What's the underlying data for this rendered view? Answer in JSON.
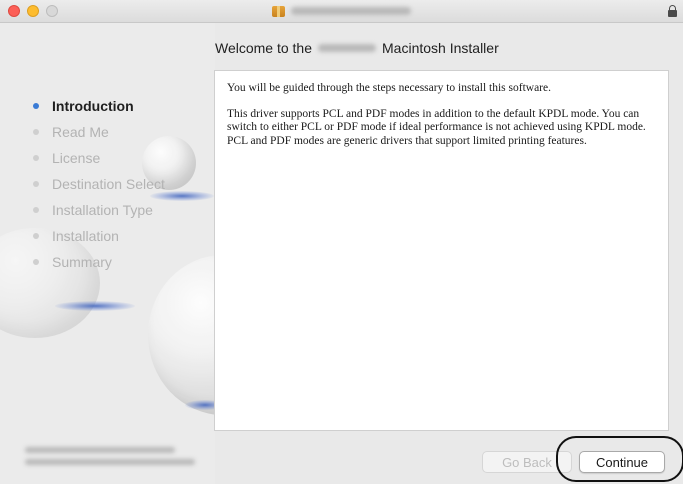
{
  "window": {
    "heading_prefix": "Welcome to the",
    "heading_suffix": "Macintosh Installer"
  },
  "sidebar": {
    "steps": [
      {
        "label": "Introduction",
        "active": true
      },
      {
        "label": "Read Me",
        "active": false
      },
      {
        "label": "License",
        "active": false
      },
      {
        "label": "Destination Select",
        "active": false
      },
      {
        "label": "Installation Type",
        "active": false
      },
      {
        "label": "Installation",
        "active": false
      },
      {
        "label": "Summary",
        "active": false
      }
    ]
  },
  "content": {
    "paragraphs": [
      "You will be guided through the steps necessary to install this software.",
      "This driver supports PCL and PDF modes in addition to the default KPDL mode. You can switch to either PCL or PDF mode if ideal performance is not achieved using KPDL mode. PCL and PDF modes are generic drivers that support limited printing features."
    ]
  },
  "buttons": {
    "back_label": "Go Back",
    "continue_label": "Continue"
  },
  "colors": {
    "accent_bullet": "#3a7bd5",
    "highlight_ring": "#111111"
  },
  "icons": {
    "title": "package-icon",
    "lock": "lock-icon"
  }
}
